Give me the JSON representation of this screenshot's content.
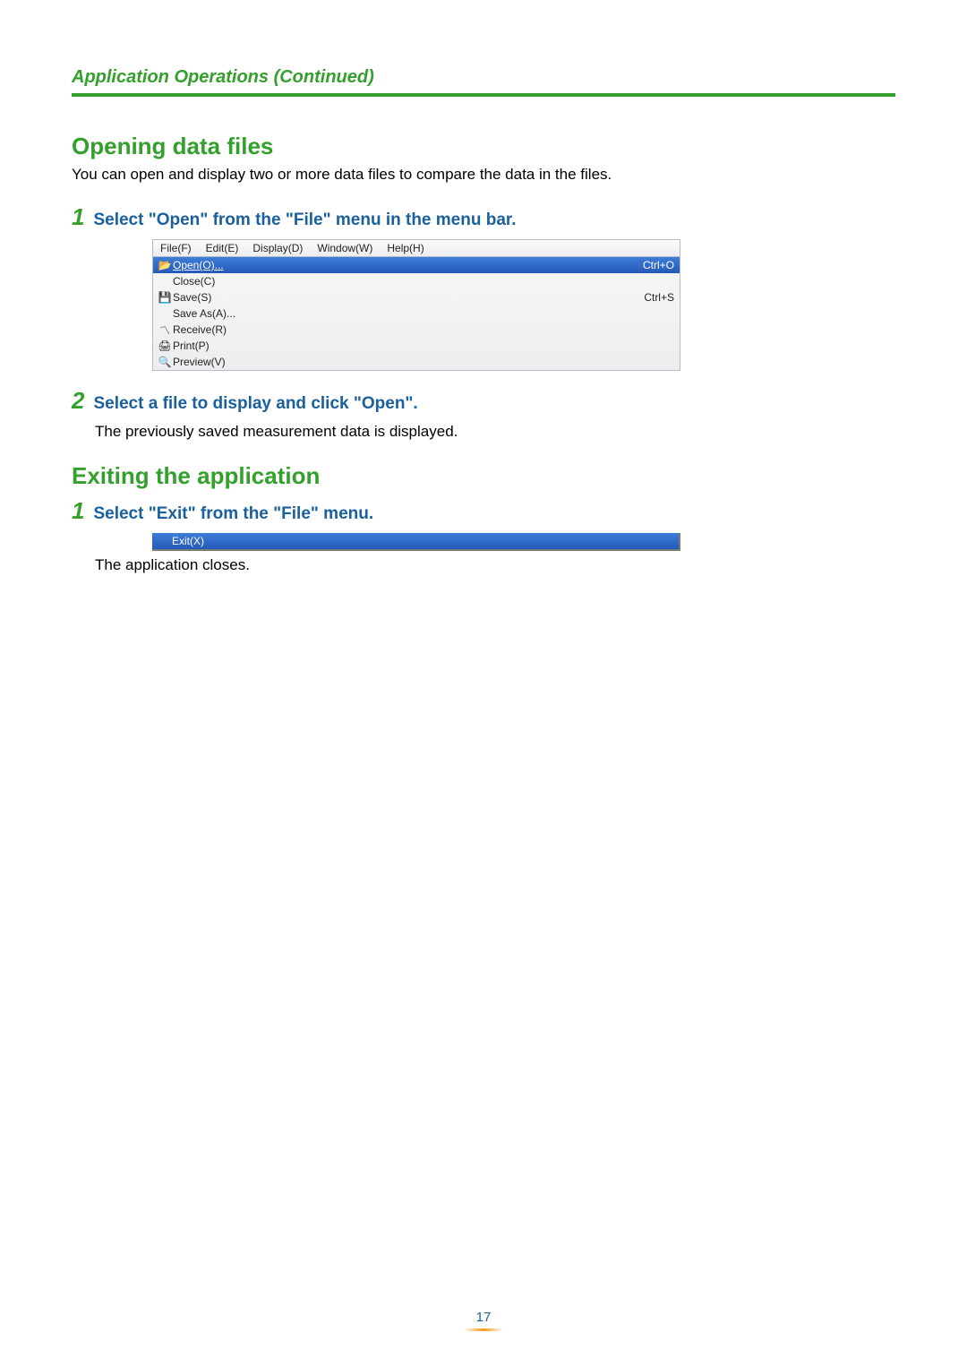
{
  "page": {
    "section_header": "Application Operations (Continued)",
    "page_number": "17"
  },
  "open_section": {
    "heading": "Opening data files",
    "intro": "You can open and display two or more data files to compare the data in the files.",
    "step1_num": "1",
    "step1_title": "Select \"Open\" from the \"File\" menu in the menu bar.",
    "step2_num": "2",
    "step2_title": "Select a file to display and click \"Open\".",
    "step2_text": "The previously saved measurement data is displayed."
  },
  "menu": {
    "bar": {
      "file": "File(F)",
      "edit": "Edit(E)",
      "display": "Display(D)",
      "window": "Window(W)",
      "help": "Help(H)"
    },
    "items": {
      "open": {
        "icon": "📂",
        "label": "Open(O)...",
        "shortcut": "Ctrl+O"
      },
      "close": {
        "icon": "",
        "label": "Close(C)",
        "shortcut": ""
      },
      "save": {
        "icon": "💾",
        "label": "Save(S)",
        "shortcut": "Ctrl+S"
      },
      "saveas": {
        "icon": "",
        "label": "Save As(A)...",
        "shortcut": ""
      },
      "receive": {
        "icon": "〽",
        "label": "Receive(R)",
        "shortcut": ""
      },
      "print": {
        "icon": "🖨",
        "label": "Print(P)",
        "shortcut": ""
      },
      "preview": {
        "icon": "🔍",
        "label": "Preview(V)",
        "shortcut": ""
      }
    }
  },
  "exit_section": {
    "heading": "Exiting the application",
    "step1_num": "1",
    "step1_title": "Select \"Exit\" from the \"File\" menu.",
    "exit_label": "Exit(X)",
    "result": "The application closes."
  }
}
